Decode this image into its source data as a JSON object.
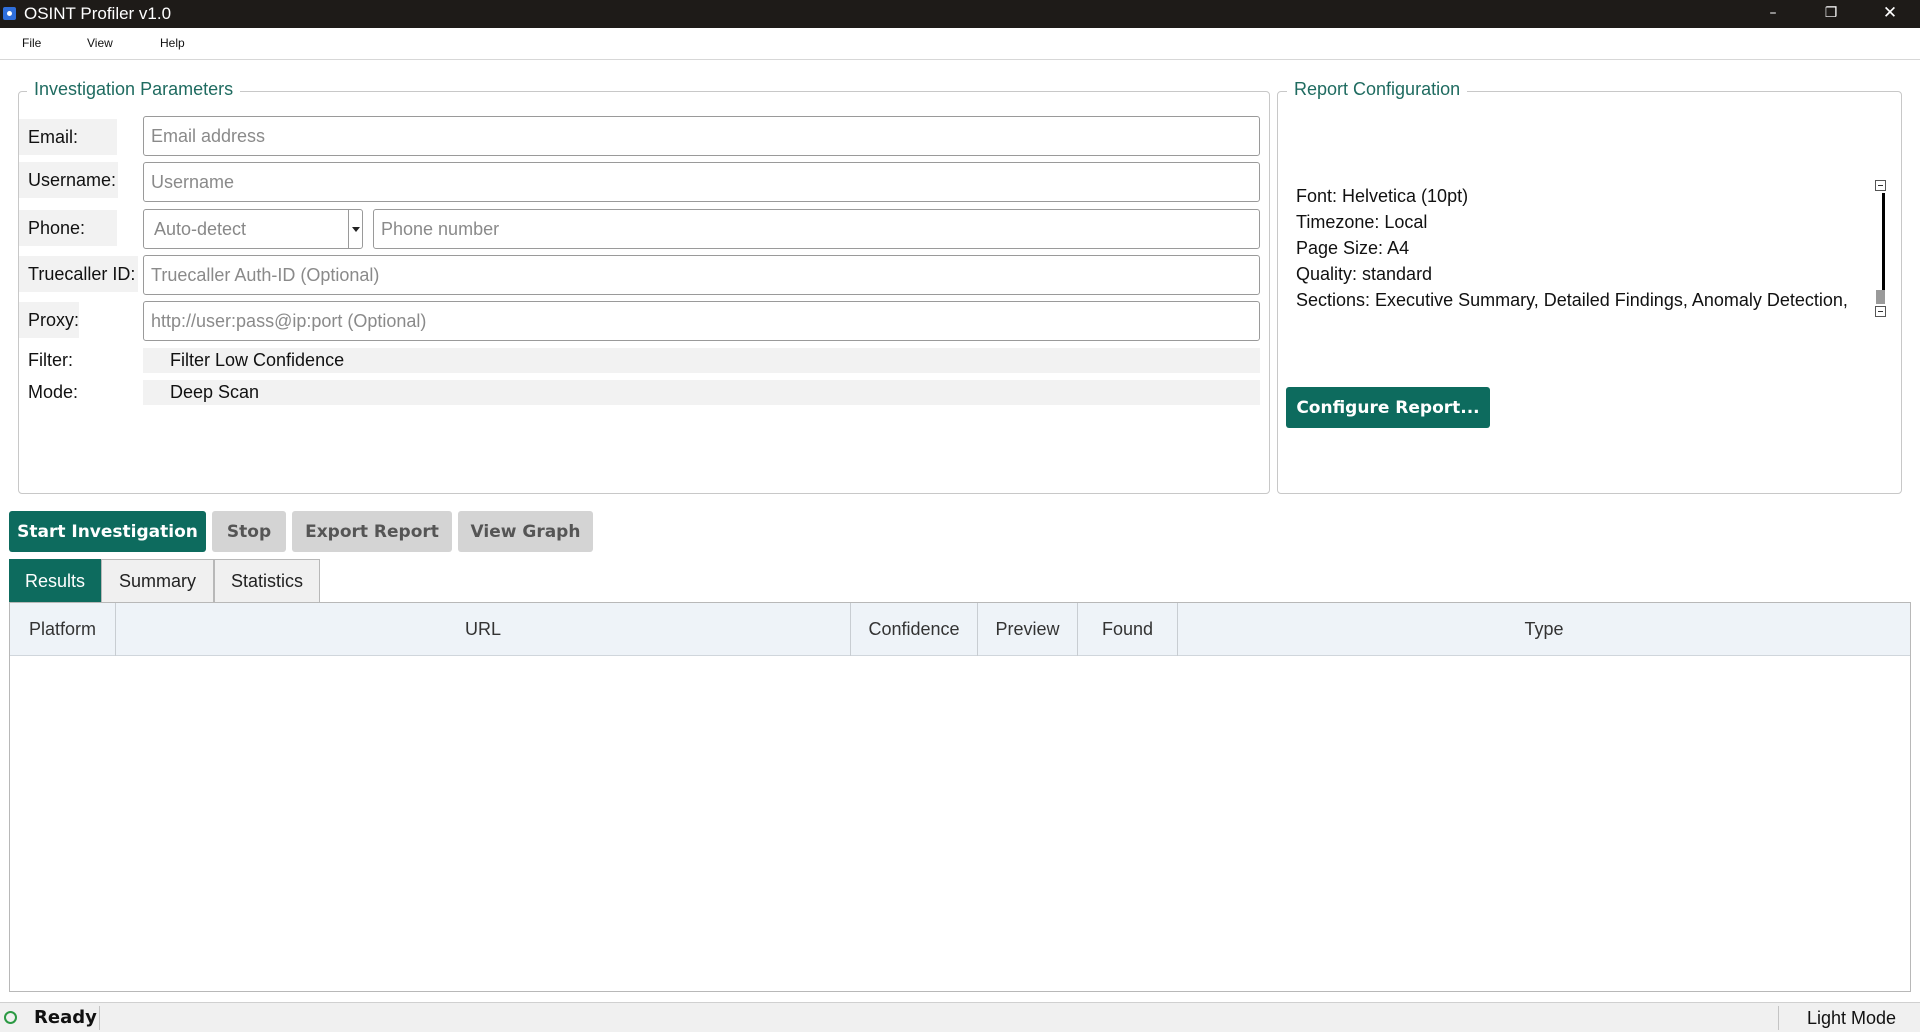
{
  "window": {
    "title": "OSINT Profiler v1.0",
    "minimize": "–",
    "maximize": "❐",
    "close": "✕"
  },
  "menu": {
    "file": "File",
    "view": "View",
    "help": "Help"
  },
  "params": {
    "group_title": "Investigation Parameters",
    "email_label": "Email:",
    "email_placeholder": "Email address",
    "username_label": "Username:",
    "username_placeholder": "Username",
    "phone_label": "Phone:",
    "phone_country": "Auto-detect",
    "phone_placeholder": "Phone number",
    "truecaller_label": "Truecaller ID:",
    "truecaller_placeholder": "Truecaller Auth-ID (Optional)",
    "proxy_label": "Proxy:",
    "proxy_placeholder": "http://user:pass@ip:port (Optional)",
    "filter_label": "Filter:",
    "filter_option": "Filter Low Confidence",
    "mode_label": "Mode:",
    "mode_option": "Deep Scan"
  },
  "report": {
    "group_title": "Report Configuration",
    "font": "Font: Helvetica (10pt)",
    "timezone": "Timezone: Local",
    "page_size": "Page Size: A4",
    "quality": "Quality: standard",
    "sections": "Sections: Executive Summary, Detailed Findings, Anomaly Detection,",
    "configure_button": "Configure Report..."
  },
  "actions": {
    "start": "Start Investigation",
    "stop": "Stop",
    "export": "Export Report",
    "graph": "View Graph"
  },
  "tabs": {
    "results": "Results",
    "summary": "Summary",
    "statistics": "Statistics"
  },
  "table": {
    "columns": [
      "Platform",
      "URL",
      "Confidence",
      "Preview",
      "Found",
      "Type"
    ]
  },
  "status": {
    "text": "Ready",
    "mode": "Light Mode",
    "ok_color": "#2c9a44"
  },
  "colors": {
    "accent": "#0d6b5e",
    "titlebar": "#1e1b18"
  }
}
